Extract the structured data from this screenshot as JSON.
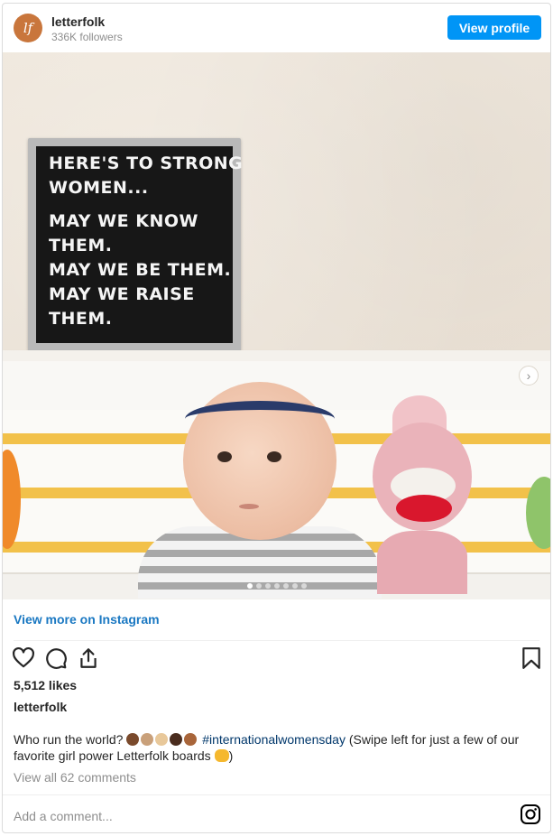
{
  "header": {
    "avatar_text": "lf",
    "username": "letterfolk",
    "followers": "336K followers",
    "view_profile_label": "View profile"
  },
  "photo": {
    "board_lines": [
      "HERE'S TO STRONG",
      "WOMEN...",
      "MAY WE KNOW",
      "THEM.",
      "MAY WE BE THEM.",
      "MAY WE RAISE",
      "THEM."
    ],
    "carousel_count": 7,
    "carousel_active": 1
  },
  "post": {
    "view_more_label": "View more on Instagram",
    "likes": "5,512 likes",
    "caption_user": "letterfolk",
    "caption_prefix": "Who run the world?",
    "hashtag": "#internationalwomensday",
    "caption_suffix": "(Swipe left for just a few of our favorite girl power Letterfolk boards",
    "caption_end": ")",
    "view_comments": "View all 62 comments"
  },
  "comment": {
    "placeholder": "Add a comment..."
  },
  "colors": {
    "accent": "#0095f6",
    "link": "#00376b",
    "muted": "#8e8e8e",
    "avatar": "#c9763c"
  },
  "icons": [
    "heart-icon",
    "comment-icon",
    "share-icon",
    "bookmark-icon",
    "chevron-right-icon",
    "instagram-icon"
  ]
}
